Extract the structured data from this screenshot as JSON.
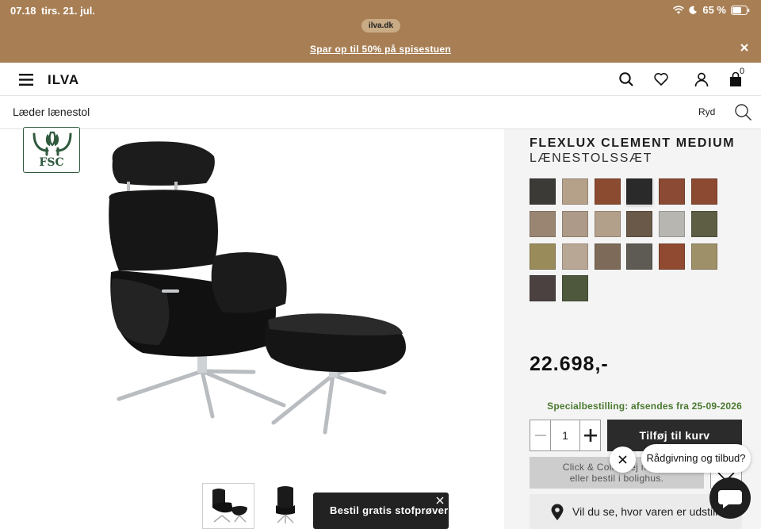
{
  "status_bar": {
    "time": "07.18",
    "date": "tirs. 21. jul.",
    "battery": "65 %"
  },
  "browser": {
    "url": "ilva.dk"
  },
  "promo": {
    "text": "Spar op til 50% på spisestuen"
  },
  "header": {
    "logo": "ILVA",
    "cart_count": "0"
  },
  "search": {
    "value": "Læder lænestol",
    "clear_label": "Ryd"
  },
  "gallery": {
    "badge": "FSC",
    "sample_button": "Bestil gratis stofprøver"
  },
  "product": {
    "name": "FLEXLUX CLEMENT MEDIUM",
    "subtitle": "LÆNESTOLSSÆT",
    "price": "22.698,-",
    "special_order": "Specialbestilling: afsendes fra 25-09-2026",
    "quantity": "1",
    "add_to_cart": "Tilføj til kurv",
    "click_collect_line1": "Click & Collect ej muligt.",
    "click_collect_line2": "eller bestil i bolighus.",
    "store_finder": "Vil du se, hvor varen er udstillet?",
    "swatches": [
      {
        "color": "#3c3a36"
      },
      {
        "color": "#b5a08a"
      },
      {
        "color": "#8b4b31"
      },
      {
        "color": "#2a2a2a",
        "selected": true
      },
      {
        "color": "#8a4a33"
      },
      {
        "color": "#8c4a33"
      },
      {
        "color": "#9a8573"
      },
      {
        "color": "#ae9a88"
      },
      {
        "color": "#b3a08b"
      },
      {
        "color": "#6a5848"
      },
      {
        "color": "#b8b6b1"
      },
      {
        "color": "#5e5e45"
      },
      {
        "color": "#9a8c5a"
      },
      {
        "color": "#b9a795"
      },
      {
        "color": "#7d6a58"
      },
      {
        "color": "#5e5a54"
      },
      {
        "color": "#8f4a31"
      },
      {
        "color": "#9e9068"
      },
      {
        "color": "#4a4140"
      },
      {
        "color": "#4d583d"
      }
    ]
  },
  "chat": {
    "bubble": "Rådgivning og tilbud?"
  }
}
